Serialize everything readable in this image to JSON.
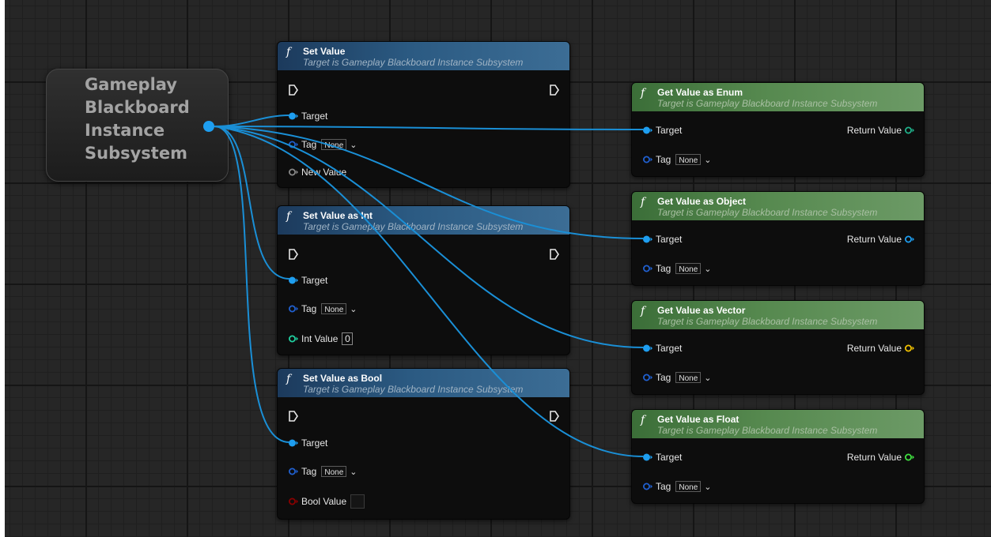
{
  "colors": {
    "target_pin": "#1e9ef0",
    "tag_pin": "#2060d0",
    "new_value_pin": "#888888",
    "int_pin": "#20d0a0",
    "bool_pin": "#8a0000",
    "enum_return": "#20b08a",
    "object_return": "#1e9ef0",
    "vector_return": "#f0c000",
    "float_return": "#40e040",
    "wire": "#1a8fd6",
    "header_blue": "#2b5a82",
    "header_green": "#56894f"
  },
  "icons": {
    "function": "f",
    "exec_pin": "exec-pin-icon",
    "dropdown": "chevron-down-icon"
  },
  "getter_node": {
    "title": "Gameplay Blackboard Instance Subsystem"
  },
  "nodes": {
    "set_value": {
      "title": "Set Value",
      "subtitle": "Target is Gameplay Blackboard Instance Subsystem",
      "target_label": "Target",
      "tag_label": "Tag",
      "tag_value": "None",
      "value_label": "New Value"
    },
    "set_value_int": {
      "title": "Set Value as Int",
      "subtitle": "Target is Gameplay Blackboard Instance Subsystem",
      "target_label": "Target",
      "tag_label": "Tag",
      "tag_value": "None",
      "value_label": "Int Value",
      "value": "0"
    },
    "set_value_bool": {
      "title": "Set Value as Bool",
      "subtitle": "Target is Gameplay Blackboard Instance Subsystem",
      "target_label": "Target",
      "tag_label": "Tag",
      "tag_value": "None",
      "value_label": "Bool Value"
    },
    "get_enum": {
      "title": "Get Value as Enum",
      "subtitle": "Target is Gameplay Blackboard Instance Subsystem",
      "target_label": "Target",
      "tag_label": "Tag",
      "tag_value": "None",
      "return_label": "Return Value"
    },
    "get_object": {
      "title": "Get Value as Object",
      "subtitle": "Target is Gameplay Blackboard Instance Subsystem",
      "target_label": "Target",
      "tag_label": "Tag",
      "tag_value": "None",
      "return_label": "Return Value"
    },
    "get_vector": {
      "title": "Get Value as Vector",
      "subtitle": "Target is Gameplay Blackboard Instance Subsystem",
      "target_label": "Target",
      "tag_label": "Tag",
      "tag_value": "None",
      "return_label": "Return Value"
    },
    "get_float": {
      "title": "Get Value as Float",
      "subtitle": "Target is Gameplay Blackboard Instance Subsystem",
      "target_label": "Target",
      "tag_label": "Tag",
      "tag_value": "None",
      "return_label": "Return Value"
    }
  }
}
